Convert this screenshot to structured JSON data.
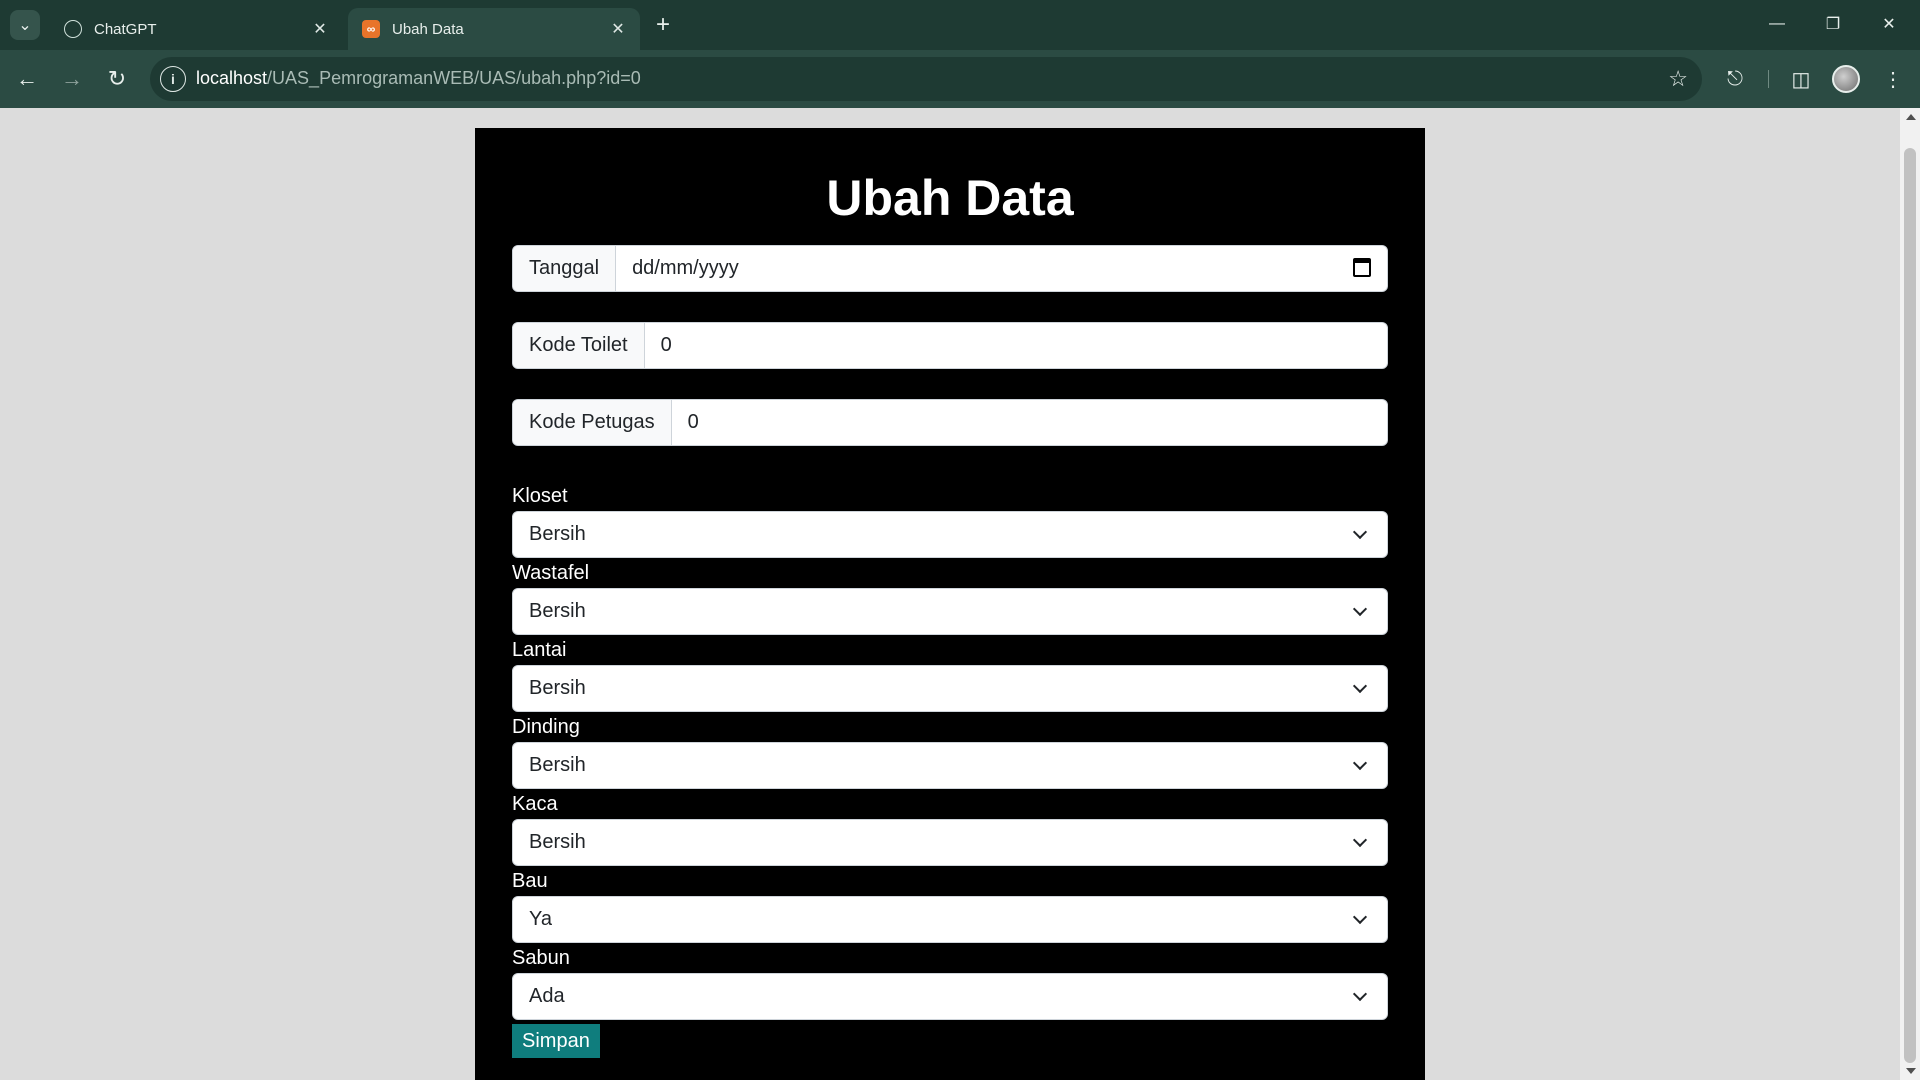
{
  "browser": {
    "tabs": [
      {
        "title": "ChatGPT",
        "active": false,
        "icon": "chatgpt-icon"
      },
      {
        "title": "Ubah Data",
        "active": true,
        "icon": "xampp-icon"
      }
    ],
    "url": {
      "host": "localhost",
      "path": "/UAS_PemrogramanWEB/UAS/ubah.php?id=0"
    }
  },
  "page": {
    "heading": "Ubah Data",
    "inputs": [
      {
        "label": "Tanggal",
        "value": "dd/mm/yyyy"
      },
      {
        "label": "Kode Toilet",
        "value": "0"
      },
      {
        "label": "Kode Petugas",
        "value": "0"
      }
    ],
    "selects": [
      {
        "label": "Kloset",
        "value": "Bersih"
      },
      {
        "label": "Wastafel",
        "value": "Bersih"
      },
      {
        "label": "Lantai",
        "value": "Bersih"
      },
      {
        "label": "Dinding",
        "value": "Bersih"
      },
      {
        "label": "Kaca",
        "value": "Bersih"
      },
      {
        "label": "Bau",
        "value": "Ya"
      },
      {
        "label": "Sabun",
        "value": "Ada"
      }
    ],
    "submit_label": "Simpan"
  },
  "colors": {
    "chrome_dark": "#1e3a33",
    "chrome_toolbar": "#2b4b43",
    "card_bg": "#000000",
    "button_bg": "#0f7d7d"
  }
}
